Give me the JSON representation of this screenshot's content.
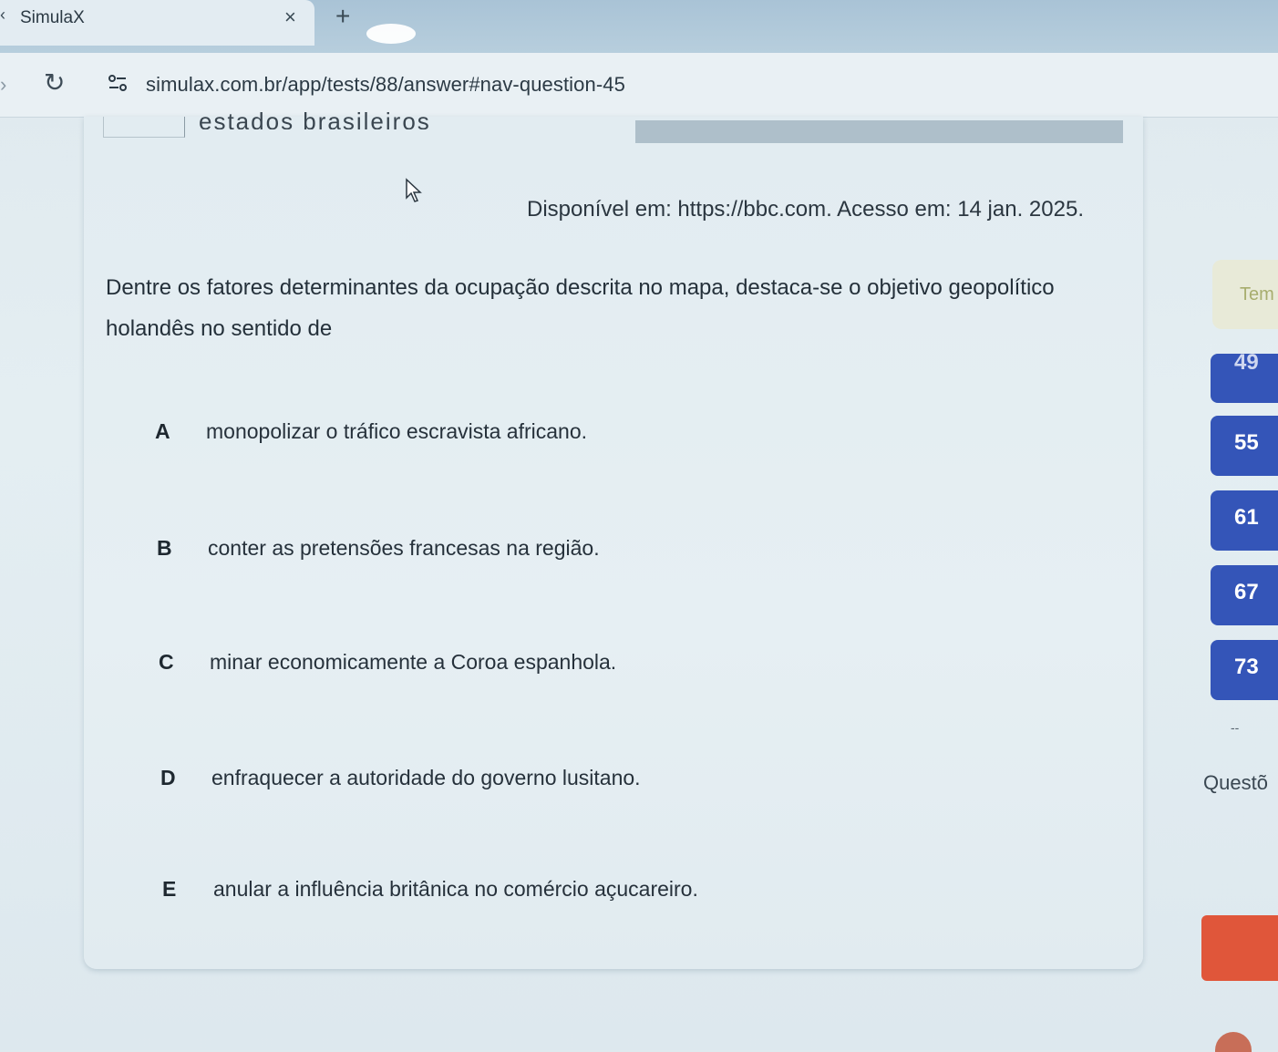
{
  "browser": {
    "tab_title": "SimulaX",
    "tab_close": "×",
    "new_tab": "+",
    "url": "simulax.com.br/app/tests/88/answer#nav-question-45"
  },
  "question": {
    "image_caption_cut": "estados brasileiros",
    "source": "Disponível em: https://bbc.com. Acesso em: 14 jan. 2025.",
    "prompt": "Dentre os fatores determinantes da ocupação descrita no mapa, destaca-se o objetivo geopolítico holandês no sentido de",
    "options": [
      {
        "letter": "A",
        "text": "monopolizar o tráfico escravista africano."
      },
      {
        "letter": "B",
        "text": "conter as pretensões francesas na região."
      },
      {
        "letter": "C",
        "text": "minar economicamente a Coroa espanhola."
      },
      {
        "letter": "D",
        "text": "enfraquecer a autoridade do governo lusitano."
      },
      {
        "letter": "E",
        "text": "anular a influência britânica no comércio açucareiro."
      }
    ]
  },
  "sidebar": {
    "timer_label": "Tem",
    "question_numbers": [
      "49",
      "55",
      "61",
      "67",
      "73"
    ],
    "questions_label": "Questõ",
    "dash": "--"
  }
}
